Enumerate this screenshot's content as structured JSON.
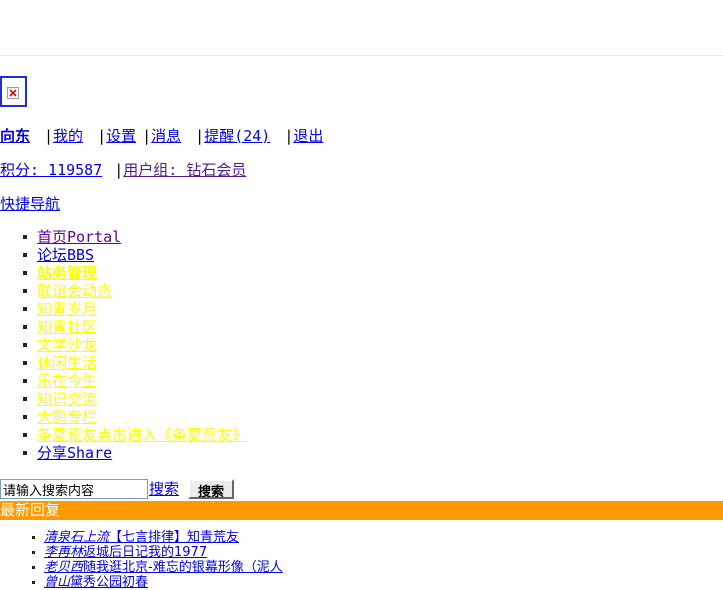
{
  "user_bar": {
    "username": "向东",
    "links": [
      "我的",
      "设置",
      "消息",
      "提醒(24)",
      "退出"
    ],
    "separator": "|"
  },
  "credits": {
    "points": "积分: 119587",
    "group": "用户组: 钻石会员",
    "separator": "|"
  },
  "quicknav": {
    "label": "快捷导航"
  },
  "nav": [
    {
      "label": "首页Portal",
      "color": "#660099"
    },
    {
      "label": "论坛BBS",
      "color": "#0000ee"
    },
    {
      "label": "站务管理",
      "color": "#ffff00"
    },
    {
      "label": "联谊会动态",
      "color": "#ffff00"
    },
    {
      "label": "知青岁月",
      "color": "#ffff00"
    },
    {
      "label": "知青社区",
      "color": "#ffff00"
    },
    {
      "label": "文学沙龙",
      "color": "#ffff00"
    },
    {
      "label": "休闲生活",
      "color": "#ffff00"
    },
    {
      "label": "乐在今生",
      "color": "#ffff00"
    },
    {
      "label": "知识交流",
      "color": "#ffff00"
    },
    {
      "label": "大鹏专栏",
      "color": "#ffff00"
    },
    {
      "label": "条夏荒友点击进入《条夏荒友》",
      "color": "#ffff00"
    },
    {
      "label": "分享Share",
      "color": "#0000ee"
    }
  ],
  "search": {
    "placeholder": "请输入搜索内容",
    "link_label": "搜索",
    "button_label": "搜索"
  },
  "latest": {
    "header": "最新回复",
    "items": [
      {
        "author": "清泉石上流",
        "title": "【七言排律】知青荒友"
      },
      {
        "author": "李再林",
        "title": "返城后日记我的1977"
      },
      {
        "author": "老贝西",
        "title": "随我逛北京-难忘的银幕形像（泥人"
      },
      {
        "author": "曾山",
        "title": "黛秀公园初春"
      }
    ]
  },
  "colors": {
    "header_bg": "#ff9900",
    "link": "#0000ee",
    "visited": "#660099",
    "highlight": "#ffff00"
  }
}
